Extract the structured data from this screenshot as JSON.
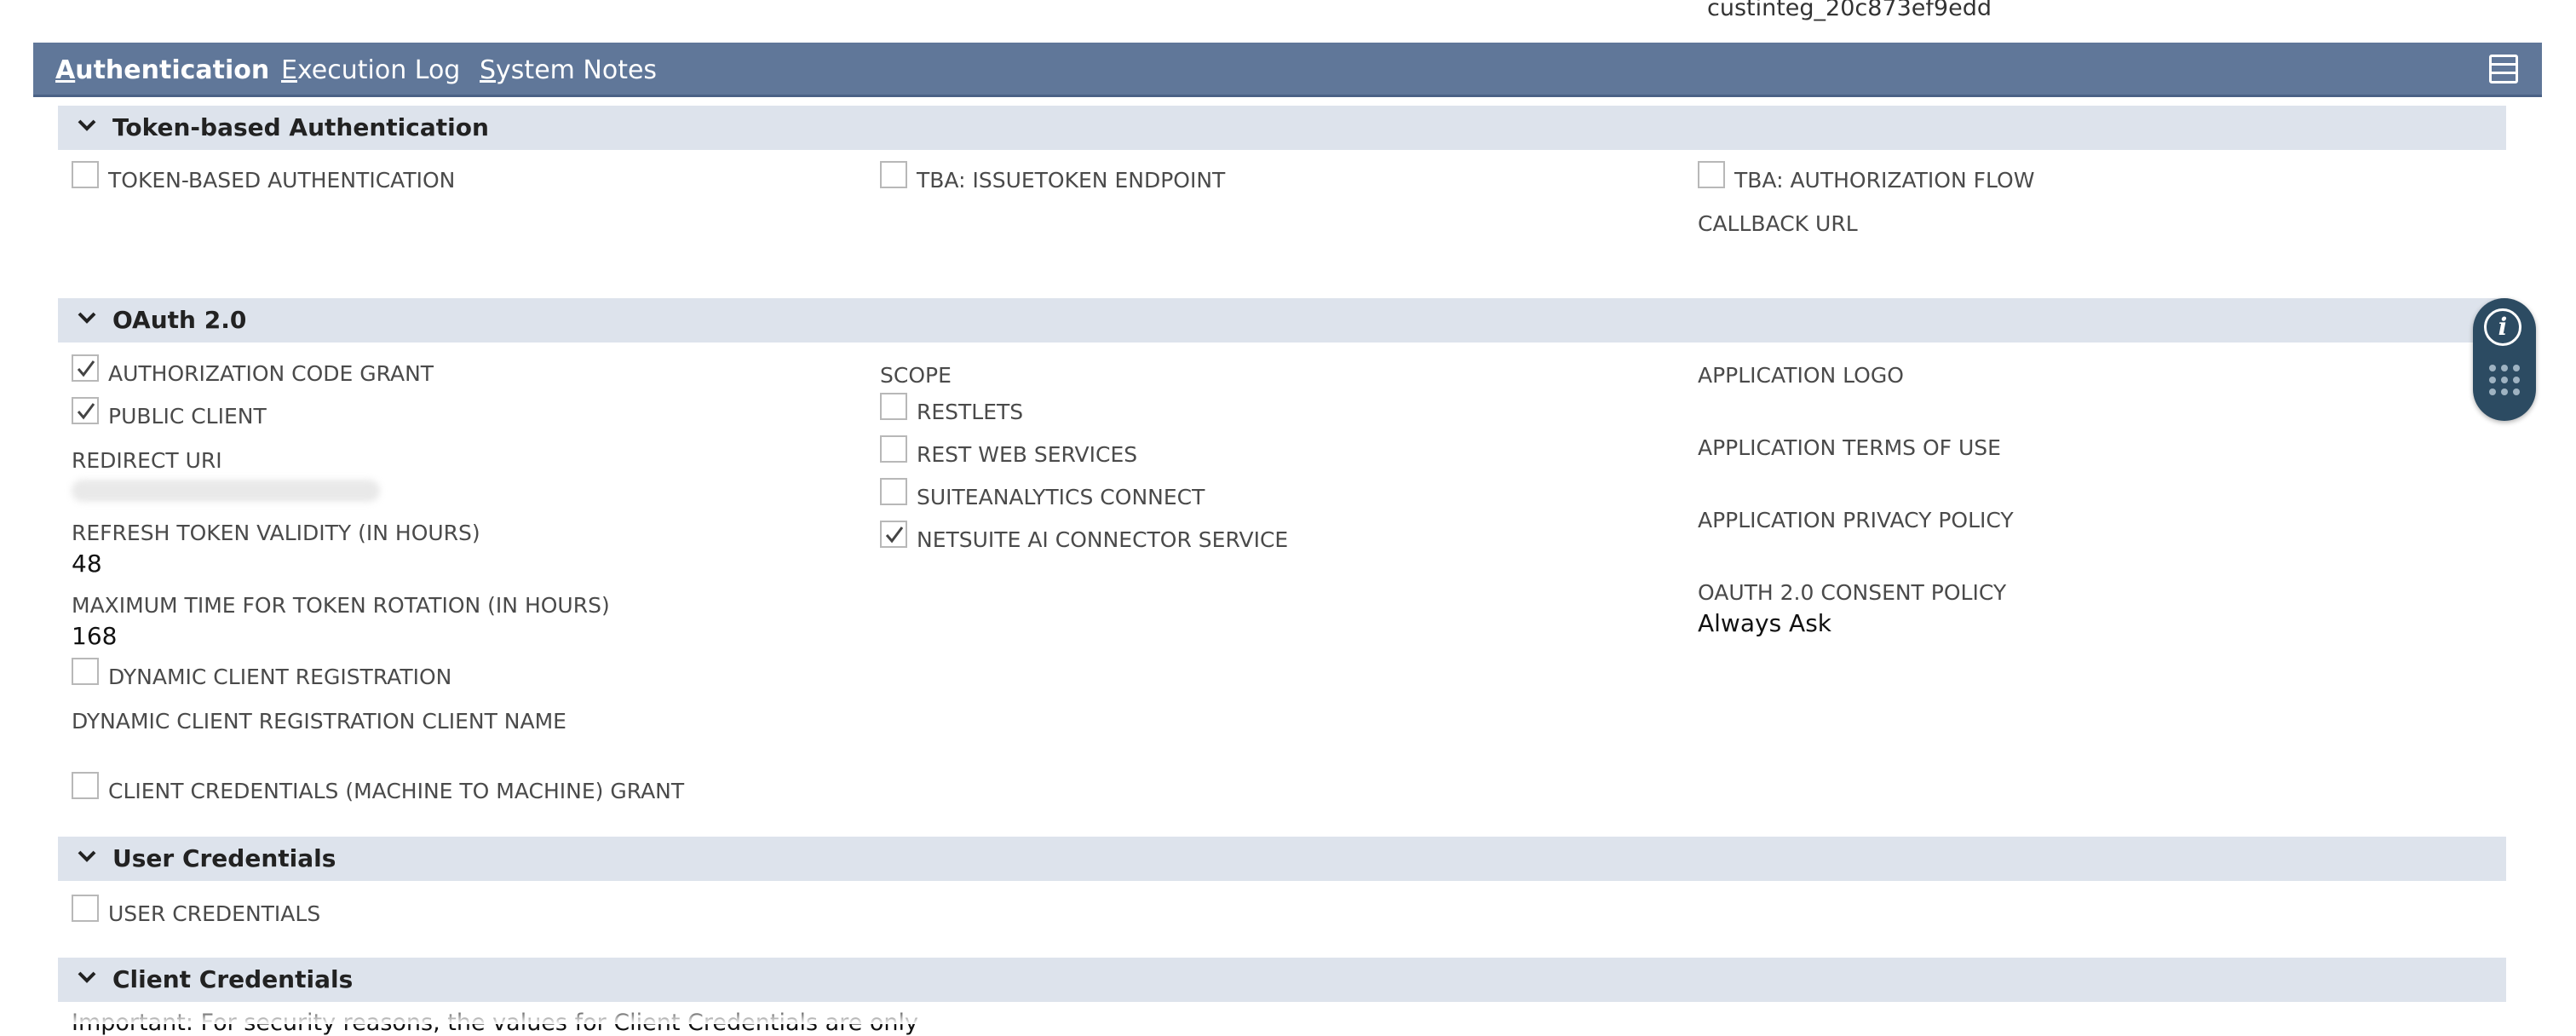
{
  "record_id": "custinteg_20c873ef9edd",
  "tabs": [
    {
      "hotkey": "A",
      "rest": "uthentication",
      "active": true
    },
    {
      "hotkey": "E",
      "rest": "xecution Log",
      "active": false
    },
    {
      "hotkey": "S",
      "rest": "ystem Notes",
      "active": false
    }
  ],
  "sections": {
    "tba": {
      "title": "Token-based Authentication"
    },
    "oauth": {
      "title": "OAuth 2.0"
    },
    "user_credentials": {
      "title": "User Credentials"
    },
    "client_credentials": {
      "title": "Client Credentials"
    }
  },
  "tba_fields": {
    "token_based_auth": {
      "label": "TOKEN-BASED AUTHENTICATION",
      "checked": false
    },
    "issuetoken_endpoint": {
      "label": "TBA: ISSUETOKEN ENDPOINT",
      "checked": false
    },
    "authorization_flow": {
      "label": "TBA: AUTHORIZATION FLOW",
      "checked": false
    },
    "callback_url_label": "CALLBACK URL"
  },
  "oauth_fields": {
    "authorization_code_grant": {
      "label": "AUTHORIZATION CODE GRANT",
      "checked": true
    },
    "public_client": {
      "label": "PUBLIC CLIENT",
      "checked": true
    },
    "redirect_uri_label": "REDIRECT URI",
    "refresh_token_validity_label": "REFRESH TOKEN VALIDITY (IN HOURS)",
    "refresh_token_validity_value": "48",
    "max_token_rotation_label": "MAXIMUM TIME FOR TOKEN ROTATION (IN HOURS)",
    "max_token_rotation_value": "168",
    "dynamic_client_registration": {
      "label": "DYNAMIC CLIENT REGISTRATION",
      "checked": false
    },
    "dynamic_client_registration_name_label": "DYNAMIC CLIENT REGISTRATION CLIENT NAME",
    "client_credentials_grant": {
      "label": "CLIENT CREDENTIALS (MACHINE TO MACHINE) GRANT",
      "checked": false
    },
    "scope_label": "SCOPE",
    "scope_restlets": {
      "label": "RESTLETS",
      "checked": false
    },
    "scope_rest_web_services": {
      "label": "REST WEB SERVICES",
      "checked": false
    },
    "scope_suiteanalytics_connect": {
      "label": "SUITEANALYTICS CONNECT",
      "checked": false
    },
    "scope_netsuite_ai_connector": {
      "label": "NETSUITE AI CONNECTOR SERVICE",
      "checked": true
    },
    "application_logo_label": "APPLICATION LOGO",
    "application_terms_label": "APPLICATION TERMS OF USE",
    "application_privacy_label": "APPLICATION PRIVACY POLICY",
    "consent_policy_label": "OAUTH 2.0 CONSENT POLICY",
    "consent_policy_value": "Always Ask"
  },
  "user_credentials_fields": {
    "user_credentials": {
      "label": "USER CREDENTIALS",
      "checked": false
    }
  },
  "client_credentials_text": "Important: For security reasons, the values for Client Credentials are only",
  "colors": {
    "tab_bar": "#607799",
    "section_header": "#dde3ec",
    "side_widget": "#2c4b62"
  },
  "icons": {
    "section_toggle": "chevron-down-icon",
    "tab_menu": "menu-icon",
    "info": "info-icon",
    "apps": "grid-dots-icon",
    "checkbox_checked": "checkmark-icon"
  }
}
